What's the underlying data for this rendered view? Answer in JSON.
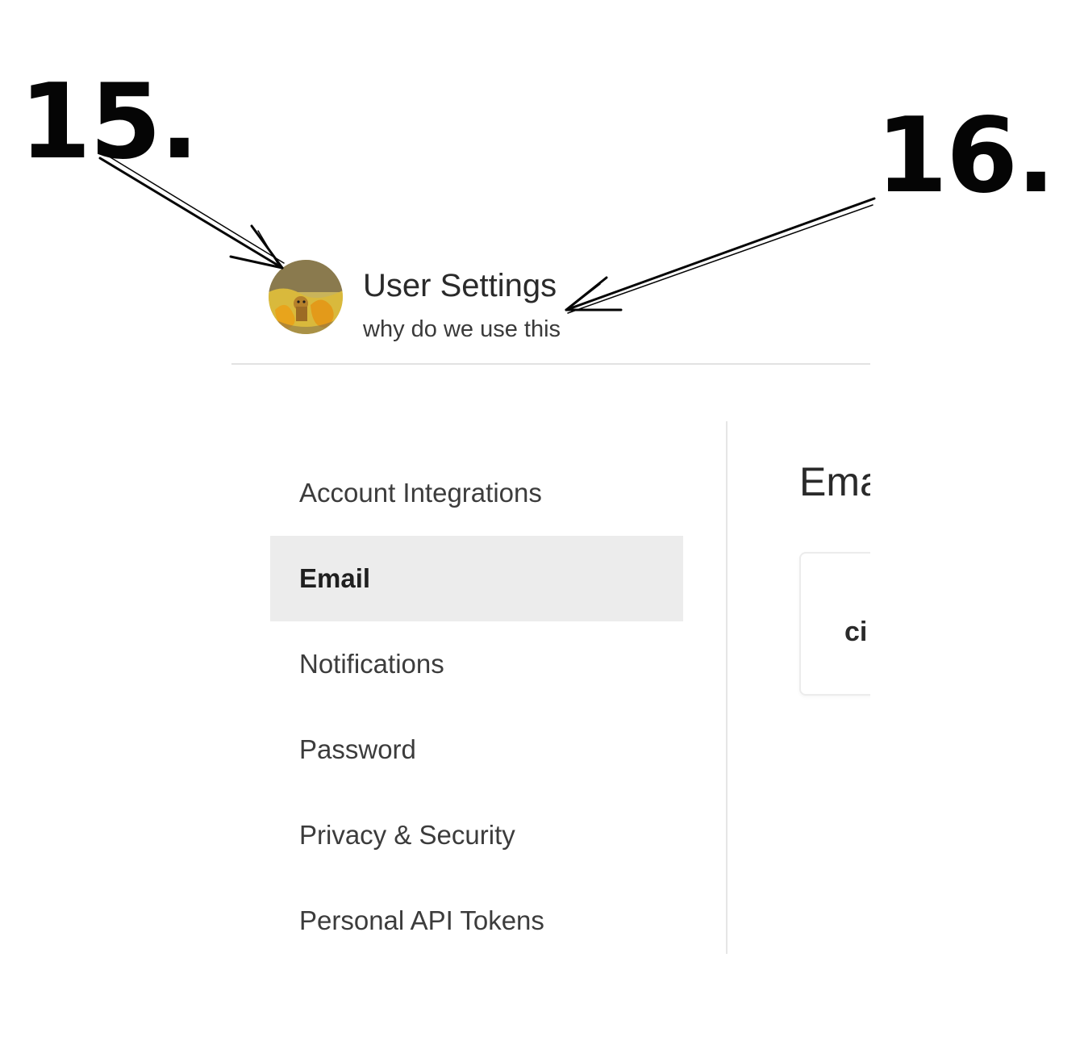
{
  "annotations": {
    "avatar_marker": "15.",
    "title_marker": "16."
  },
  "header": {
    "avatar_icon": "user-avatar-image",
    "title": "User Settings",
    "subtitle": "why do we use this"
  },
  "sidebar": {
    "items": [
      {
        "label": "Account Integrations",
        "active": false
      },
      {
        "label": "Email",
        "active": true
      },
      {
        "label": "Notifications",
        "active": false
      },
      {
        "label": "Password",
        "active": false
      },
      {
        "label": "Privacy & Security",
        "active": false
      },
      {
        "label": "Personal API Tokens",
        "active": false
      }
    ]
  },
  "main": {
    "title": "Ema",
    "email_card": {
      "value": "ci"
    }
  },
  "colors": {
    "active_item_bg": "#ececec",
    "divider": "#e2e2e2",
    "annotation_ink": "#050505"
  }
}
